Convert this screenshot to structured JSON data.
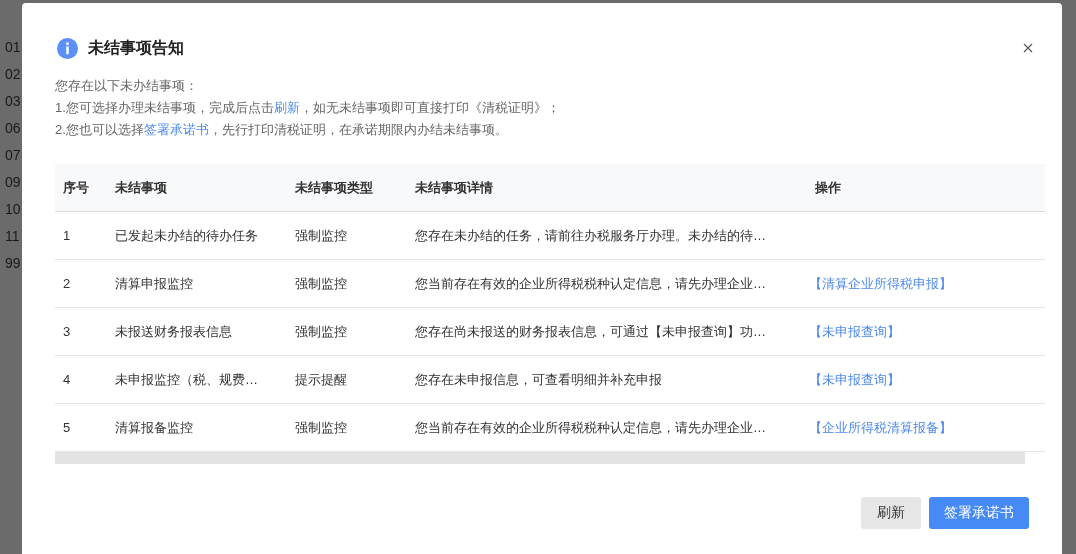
{
  "background": {
    "numbers": [
      "01",
      "02",
      "03",
      "06",
      "07",
      "09",
      "10",
      "11",
      "99"
    ]
  },
  "dialog": {
    "title": "未结事项告知",
    "intro": "您存在以下未办结事项：",
    "lines": [
      [
        {
          "kind": "text",
          "text": "1.您可选择办理未结事项，完成后点击"
        },
        {
          "kind": "link",
          "text": "刷新"
        },
        {
          "kind": "text",
          "text": "，如无未结事项即可直接打印《清税证明》；"
        }
      ],
      [
        {
          "kind": "text",
          "text": "2.您也可以选择"
        },
        {
          "kind": "link",
          "text": "签署承诺书"
        },
        {
          "kind": "text",
          "text": "，先行打印清税证明，在承诺期限内办结未结事项。"
        }
      ]
    ],
    "table": {
      "columns": [
        "序号",
        "未结事项",
        "未结事项类型",
        "未结事项详情",
        "操作"
      ],
      "rows": [
        {
          "no": "1",
          "item": "已发起未办结的待办任务",
          "type": "强制监控",
          "detail": "您存在未办结的任务，请前往办税服务厅办理。未办结的待…"
        },
        {
          "no": "2",
          "item": "清算申报监控",
          "type": "强制监控",
          "detail": "您当前存在有效的企业所得税税种认定信息，请先办理企业…",
          "action": "【清算企业所得税申报】"
        },
        {
          "no": "3",
          "item": "未报送财务报表信息",
          "type": "强制监控",
          "detail": "您存在尚未报送的财务报表信息，可通过【未申报查询】功…",
          "action": "【未申报查询】"
        },
        {
          "no": "4",
          "item": "未申报监控（税、规费…",
          "type": "提示提醒",
          "detail": "您存在未申报信息，可查看明细并补充申报",
          "action": "【未申报查询】"
        },
        {
          "no": "5",
          "item": "清算报备监控",
          "type": "强制监控",
          "detail": "您当前存在有效的企业所得税税种认定信息，请先办理企业…",
          "action": "【企业所得税清算报备】"
        }
      ]
    },
    "buttons": [
      {
        "label": "刷新",
        "kind": "default"
      },
      {
        "label": "签署承诺书",
        "kind": "primary"
      }
    ]
  }
}
